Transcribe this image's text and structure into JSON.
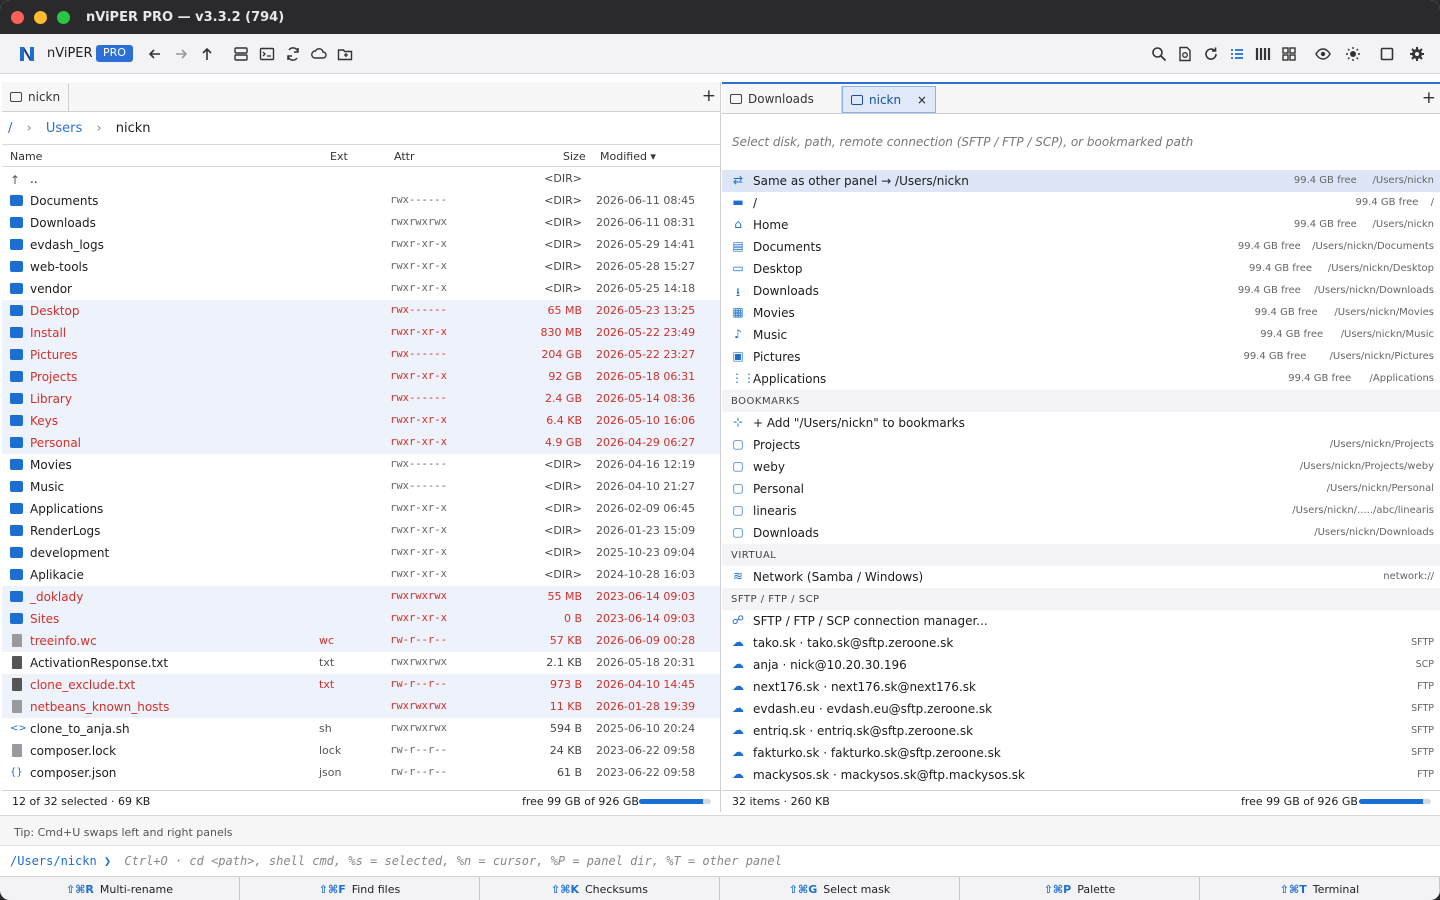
{
  "window": {
    "title": "nViPER PRO — v3.3.2 (794)"
  },
  "toolbar": {
    "app_name": "nViPER",
    "badge": "PRO",
    "accent": "#2c6fd6"
  },
  "left": {
    "tab": "nickn",
    "breadcrumb": {
      "root": "/",
      "users": "Users",
      "current": "nickn"
    },
    "columns": {
      "name": "Name",
      "ext": "Ext",
      "attr": "Attr",
      "size": "Size",
      "modified": "Modified ▾"
    },
    "rows": [
      {
        "name": "..",
        "ext": "",
        "attr": "",
        "size": "<DIR>",
        "mod": "",
        "sel": false,
        "type": "up"
      },
      {
        "name": "Documents",
        "ext": "",
        "attr": "rwx------",
        "size": "<DIR>",
        "mod": "2026-06-11 08:45",
        "sel": false,
        "type": "dir"
      },
      {
        "name": "Downloads",
        "ext": "",
        "attr": "rwxrwxrwx",
        "size": "<DIR>",
        "mod": "2026-06-11 08:31",
        "sel": false,
        "type": "dir"
      },
      {
        "name": "evdash_logs",
        "ext": "",
        "attr": "rwxr-xr-x",
        "size": "<DIR>",
        "mod": "2026-05-29 14:41",
        "sel": false,
        "type": "dir"
      },
      {
        "name": "web-tools",
        "ext": "",
        "attr": "rwxr-xr-x",
        "size": "<DIR>",
        "mod": "2026-05-28 15:27",
        "sel": false,
        "type": "dir"
      },
      {
        "name": "vendor",
        "ext": "",
        "attr": "rwxr-xr-x",
        "size": "<DIR>",
        "mod": "2026-05-25 14:18",
        "sel": false,
        "type": "dir"
      },
      {
        "name": "Desktop",
        "ext": "",
        "attr": "rwx------",
        "size": "65 MB",
        "mod": "2026-05-23 13:25",
        "sel": true,
        "type": "dir"
      },
      {
        "name": "Install",
        "ext": "",
        "attr": "rwxr-xr-x",
        "size": "830 MB",
        "mod": "2026-05-22 23:49",
        "sel": true,
        "type": "dir"
      },
      {
        "name": "Pictures",
        "ext": "",
        "attr": "rwx------",
        "size": "204 GB",
        "mod": "2026-05-22 23:27",
        "sel": true,
        "type": "dir"
      },
      {
        "name": "Projects",
        "ext": "",
        "attr": "rwxr-xr-x",
        "size": "92 GB",
        "mod": "2026-05-18 06:31",
        "sel": true,
        "type": "dir"
      },
      {
        "name": "Library",
        "ext": "",
        "attr": "rwx------",
        "size": "2.4 GB",
        "mod": "2026-05-14 08:36",
        "sel": true,
        "type": "dir"
      },
      {
        "name": "Keys",
        "ext": "",
        "attr": "rwxr-xr-x",
        "size": "6.4 KB",
        "mod": "2026-05-10 16:06",
        "sel": true,
        "type": "dir"
      },
      {
        "name": "Personal",
        "ext": "",
        "attr": "rwxr-xr-x",
        "size": "4.9 GB",
        "mod": "2026-04-29 06:27",
        "sel": true,
        "type": "dir"
      },
      {
        "name": "Movies",
        "ext": "",
        "attr": "rwx------",
        "size": "<DIR>",
        "mod": "2026-04-16 12:19",
        "sel": false,
        "type": "dir"
      },
      {
        "name": "Music",
        "ext": "",
        "attr": "rwx------",
        "size": "<DIR>",
        "mod": "2026-04-10 21:27",
        "sel": false,
        "type": "dir"
      },
      {
        "name": "Applications",
        "ext": "",
        "attr": "rwxr-xr-x",
        "size": "<DIR>",
        "mod": "2026-02-09 06:45",
        "sel": false,
        "type": "dir"
      },
      {
        "name": "RenderLogs",
        "ext": "",
        "attr": "rwxr-xr-x",
        "size": "<DIR>",
        "mod": "2026-01-23 15:09",
        "sel": false,
        "type": "dir"
      },
      {
        "name": "development",
        "ext": "",
        "attr": "rwxr-xr-x",
        "size": "<DIR>",
        "mod": "2025-10-23 09:04",
        "sel": false,
        "type": "dir"
      },
      {
        "name": "Aplikacie",
        "ext": "",
        "attr": "rwxr-xr-x",
        "size": "<DIR>",
        "mod": "2024-10-28 16:03",
        "sel": false,
        "type": "dir"
      },
      {
        "name": "_doklady",
        "ext": "",
        "attr": "rwxrwxrwx",
        "size": "55 MB",
        "mod": "2023-06-14 09:03",
        "sel": true,
        "type": "dir"
      },
      {
        "name": "Sites",
        "ext": "",
        "attr": "rwxr-xr-x",
        "size": "0 B",
        "mod": "2023-06-14 09:03",
        "sel": true,
        "type": "dir"
      },
      {
        "name": "treeinfo.wc",
        "ext": "wc",
        "attr": "rw-r--r--",
        "size": "57 KB",
        "mod": "2026-06-09 00:28",
        "sel": true,
        "type": "file"
      },
      {
        "name": "ActivationResponse.txt",
        "ext": "txt",
        "attr": "rwxrwxrwx",
        "size": "2.1 KB",
        "mod": "2026-05-18 20:31",
        "sel": false,
        "type": "text"
      },
      {
        "name": "clone_exclude.txt",
        "ext": "txt",
        "attr": "rw-r--r--",
        "size": "973 B",
        "mod": "2026-04-10 14:45",
        "sel": true,
        "type": "text"
      },
      {
        "name": "netbeans_known_hosts",
        "ext": "",
        "attr": "rwxrwxrwx",
        "size": "11 KB",
        "mod": "2026-01-28 19:39",
        "sel": true,
        "type": "file"
      },
      {
        "name": "clone_to_anja.sh",
        "ext": "sh",
        "attr": "rwxrwxrwx",
        "size": "594 B",
        "mod": "2025-06-10 20:24",
        "sel": false,
        "type": "code"
      },
      {
        "name": "composer.lock",
        "ext": "lock",
        "attr": "rw-r--r--",
        "size": "24 KB",
        "mod": "2023-06-22 09:58",
        "sel": false,
        "type": "file"
      },
      {
        "name": "composer.json",
        "ext": "json",
        "attr": "rw-r--r--",
        "size": "61 B",
        "mod": "2023-06-22 09:58",
        "sel": false,
        "type": "json"
      }
    ],
    "status": {
      "selected": "12 of 32 selected · 69 KB",
      "free": "free 99 GB of 926 GB",
      "usage_fraction": 0.89
    }
  },
  "right": {
    "tabs": [
      {
        "label": "Downloads",
        "active": false
      },
      {
        "label": "nickn",
        "active": true,
        "close": "×"
      }
    ],
    "hint": "Select disk, path, remote connection (SFTP / FTP / SCP), or bookmarked path",
    "places": [
      {
        "icon": "⇄",
        "label": "Same as other panel  →  /Users/nickn",
        "free": "99.4 GB free",
        "path": "/Users/nickn",
        "hl": true
      },
      {
        "icon": "▬",
        "label": "/",
        "free": "99.4 GB free",
        "path": "/"
      },
      {
        "icon": "⌂",
        "label": "Home",
        "free": "99.4 GB free",
        "path": "/Users/nickn"
      },
      {
        "icon": "▤",
        "label": "Documents",
        "free": "99.4 GB free",
        "path": "/Users/nickn/Documents"
      },
      {
        "icon": "▭",
        "label": "Desktop",
        "free": "99.4 GB free",
        "path": "/Users/nickn/Desktop"
      },
      {
        "icon": "⭳",
        "label": "Downloads",
        "free": "99.4 GB free",
        "path": "/Users/nickn/Downloads"
      },
      {
        "icon": "▦",
        "label": "Movies",
        "free": "99.4 GB free",
        "path": "/Users/nickn/Movies"
      },
      {
        "icon": "♪",
        "label": "Music",
        "free": "99.4 GB free",
        "path": "/Users/nickn/Music"
      },
      {
        "icon": "▣",
        "label": "Pictures",
        "free": "99.4 GB free",
        "path": "/Users/nickn/Pictures"
      },
      {
        "icon": "⋮⋮",
        "label": "Applications",
        "free": "99.4 GB free",
        "path": "/Applications"
      }
    ],
    "bookmarks_header": "BOOKMARKS",
    "bookmarks": [
      {
        "icon": "⊹",
        "label": "+ Add \"/Users/nickn\" to bookmarks",
        "path": ""
      },
      {
        "icon": "▢",
        "label": "Projects",
        "path": "/Users/nickn/Projects"
      },
      {
        "icon": "▢",
        "label": "weby",
        "path": "/Users/nickn/Projects/weby"
      },
      {
        "icon": "▢",
        "label": "Personal",
        "path": "/Users/nickn/Personal"
      },
      {
        "icon": "▢",
        "label": "linearis",
        "path": "/Users/nickn/...../abc/linearis"
      },
      {
        "icon": "▢",
        "label": "Downloads",
        "path": "/Users/nickn/Downloads"
      }
    ],
    "virtual_header": "VIRTUAL",
    "virtual": [
      {
        "icon": "≋",
        "label": "Network (Samba / Windows)",
        "path": "network://"
      }
    ],
    "sftp_header": "SFTP / FTP / SCP",
    "remotes": [
      {
        "icon": "☍",
        "label": "SFTP / FTP / SCP connection manager...",
        "proto": ""
      },
      {
        "icon": "☁",
        "label": "tako.sk  ·  tako.sk@sftp.zeroone.sk",
        "proto": "SFTP"
      },
      {
        "icon": "☁",
        "label": "anja  ·  nick@10.20.30.196",
        "proto": "SCP"
      },
      {
        "icon": "☁",
        "label": "next176.sk  ·  next176.sk@next176.sk",
        "proto": "FTP"
      },
      {
        "icon": "☁",
        "label": "evdash.eu  ·  evdash.eu@sftp.zeroone.sk",
        "proto": "SFTP"
      },
      {
        "icon": "☁",
        "label": "entriq.sk  ·  entriq.sk@sftp.zeroone.sk",
        "proto": "SFTP"
      },
      {
        "icon": "☁",
        "label": "fakturko.sk  ·  fakturko.sk@sftp.zeroone.sk",
        "proto": "SFTP"
      },
      {
        "icon": "☁",
        "label": "mackysos.sk  ·  mackysos.sk@ftp.mackysos.sk",
        "proto": "FTP"
      }
    ],
    "status": {
      "items": "32 items · 260 KB",
      "free": "free 99 GB of 926 GB",
      "usage_fraction": 0.89
    }
  },
  "tip": "Tip: Cmd+U swaps left and right panels",
  "cmdline": {
    "path": "/Users/nickn ❯",
    "hint": "Ctrl+O · cd <path>, shell cmd, %s = selected, %n = cursor, %P = panel dir, %T = other panel"
  },
  "fkeys": [
    {
      "key": "⇧⌘R",
      "label": "Multi-rename"
    },
    {
      "key": "⇧⌘F",
      "label": "Find files"
    },
    {
      "key": "⇧⌘K",
      "label": "Checksums"
    },
    {
      "key": "⇧⌘G",
      "label": "Select mask"
    },
    {
      "key": "⇧⌘P",
      "label": "Palette"
    },
    {
      "key": "⇧⌘T",
      "label": "Terminal"
    }
  ]
}
